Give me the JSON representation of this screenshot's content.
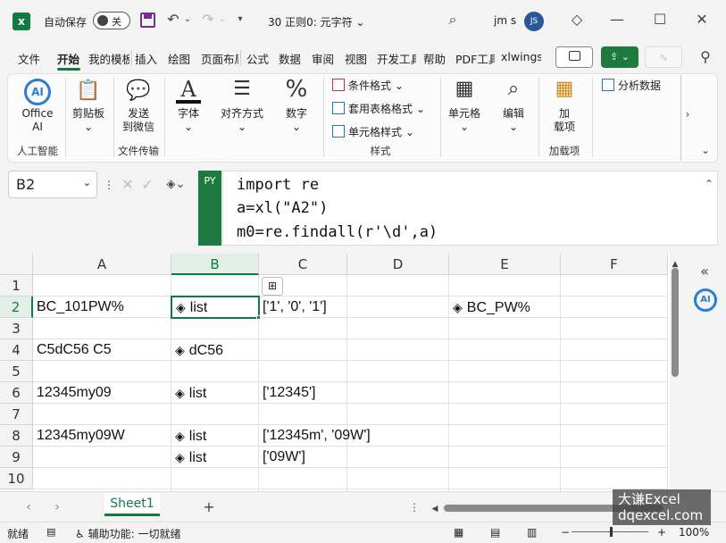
{
  "titlebar": {
    "autosave_label": "自动保存",
    "autosave_state": "关",
    "file_title": "30 正则0: 元字符",
    "user": "jm s",
    "avatar_initials": "JS"
  },
  "menu": [
    "文件",
    "开始",
    "我的模板",
    "插入",
    "绘图",
    "页面布局",
    "公式",
    "数据",
    "审阅",
    "视图",
    "开发工具",
    "帮助",
    "PDF工具",
    "xlwings"
  ],
  "ribbon": {
    "office_ai": {
      "line1": "Office",
      "line2": "AI",
      "group": "人工智能"
    },
    "clipboard": "剪贴板",
    "send": {
      "line1": "发送",
      "line2": "到微信",
      "group": "文件传输"
    },
    "font": "字体",
    "align": "对齐方式",
    "number": "数字",
    "styles": {
      "cond": "条件格式",
      "table": "套用表格格式",
      "cell": "单元格样式",
      "group": "样式"
    },
    "cells": "单元格",
    "edit": "编辑",
    "addin": {
      "line1": "加",
      "line2": "载项",
      "group": "加载项"
    },
    "analysis": "分析数据"
  },
  "formula_bar": {
    "name_box": "B2",
    "badge": "PY",
    "lines": [
      "import re",
      "a=xl(\"A2\")",
      "m0=re.findall(r'\\d',a)"
    ]
  },
  "grid": {
    "columns": [
      "A",
      "B",
      "C",
      "D",
      "E",
      "F"
    ],
    "rows": [
      "1",
      "2",
      "3",
      "4",
      "5",
      "6",
      "7",
      "8",
      "9",
      "10"
    ],
    "cells": {
      "A2": "BC_101PW%",
      "B2": "list",
      "C2": "['1', '0', '1']",
      "E2": "BC_PW%",
      "A4": "C5dC56 C5",
      "B4": "dC56",
      "A6": "12345my09",
      "B6": "list",
      "C6": "['12345']",
      "A8": "12345my09W",
      "B8": "list",
      "C8": "['12345m', '09W']",
      "B9": "list",
      "C9": "['09W']"
    }
  },
  "sheet_tab": "Sheet1",
  "status": {
    "ready": "就绪",
    "accessibility": "辅助功能: 一切就绪",
    "zoom": "100%"
  },
  "watermark": {
    "line1": "大谦Excel",
    "line2": "dqexcel.com"
  }
}
